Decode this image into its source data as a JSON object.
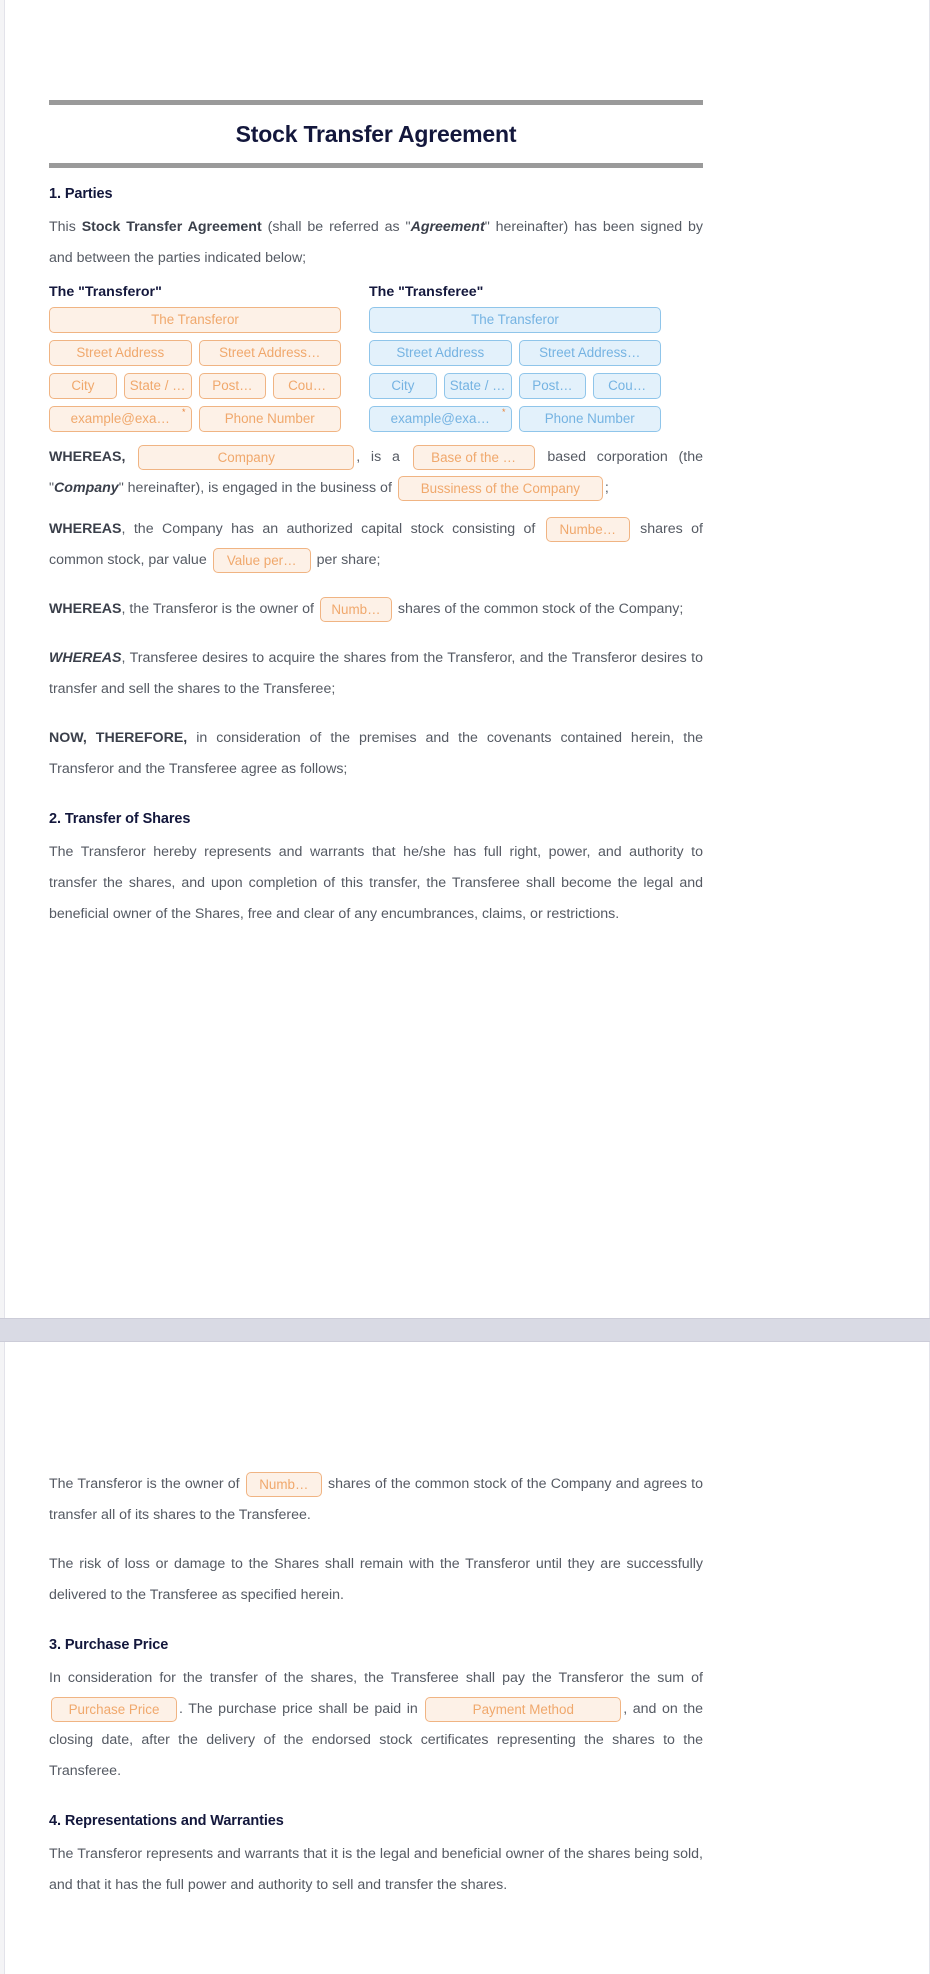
{
  "document": {
    "title": "Stock Transfer Agreement"
  },
  "sections": {
    "parties": {
      "heading": "1. Parties",
      "intro_a": "This ",
      "intro_b": "Stock Transfer Agreement",
      "intro_c": " (shall be referred as \"",
      "intro_d": "Agreement",
      "intro_e": "\" hereinafter) has been signed by and between the parties indicated below;",
      "transferor_label": "The \"Transferor\"",
      "transferee_label": "The \"Transferee\"",
      "transferor_fields": {
        "name": "The Transferor",
        "street_address_1": "Street Address",
        "street_address_2": "Street Address…",
        "city": "City",
        "state": "State / …",
        "postal": "Post…",
        "country": "Cou…",
        "email": "example@exa…",
        "email_required": "*",
        "phone": "Phone Number"
      },
      "transferee_fields": {
        "name": "The Transferor",
        "street_address_1": "Street Address",
        "street_address_2": "Street Address…",
        "city": "City",
        "state": "State / …",
        "postal": "Post…",
        "country": "Cou…",
        "email": "example@exa…",
        "email_required": "*",
        "phone": "Phone Number"
      }
    },
    "whereas_1": {
      "lead": "WHEREAS,",
      "field_company": "Company",
      "mid_1": ", is a",
      "field_base": "Base of the …",
      "mid_2": "based corporation (the \"",
      "company_italic": "Company",
      "mid_3": "\" hereinafter), is engaged in the business of",
      "field_business": "Bussiness of the Company",
      "tail": ";"
    },
    "whereas_2": {
      "lead": "WHEREAS",
      "text_1": ", the Company has an authorized capital stock consisting of",
      "field_number": "Numbe…",
      "text_2": "shares of common stock, par value",
      "field_value": "Value per…",
      "text_3": "per share;"
    },
    "whereas_3": {
      "lead": "WHEREAS",
      "text_1": ", the Transferor is the owner of",
      "field_number": "Numb…",
      "text_2": "shares of the common stock of the Company;"
    },
    "whereas_4": {
      "lead": "WHEREAS",
      "text": ", Transferee desires to acquire the shares from the Transferor, and the Transferor desires to transfer and sell the shares to the Transferee;"
    },
    "now_therefore": {
      "lead": "NOW, THEREFORE,",
      "text": " in consideration of the premises and the covenants contained herein, the Transferor and the Transferee agree as follows;"
    },
    "transfer_of_shares": {
      "heading": "2. Transfer of Shares",
      "paragraph_1": "The Transferor hereby represents and warrants that he/she has full right, power, and authority to transfer the shares, and upon completion of this transfer, the Transferee shall become the legal and beneficial owner of the Shares, free and clear of any encumbrances, claims, or restrictions.",
      "paragraph_2_text_1": "The Transferor is the owner of",
      "paragraph_2_field": "Numb…",
      "paragraph_2_text_2": "shares of the common stock of the Company and agrees to transfer all of its shares to the Transferee.",
      "paragraph_3": "The risk of loss or damage to the Shares shall remain with the Transferor until they are successfully delivered to the Transferee as specified herein."
    },
    "purchase_price": {
      "heading": "3. Purchase Price",
      "text_1": "In consideration for the transfer of the shares, the Transferee shall pay the Transferor the sum of",
      "field_price": "Purchase Price",
      "text_2": ". The purchase price shall be paid in",
      "field_method": "Payment Method",
      "text_3": ", and on the closing date, after the delivery of the endorsed stock certificates representing the shares to the Transferee."
    },
    "representations": {
      "heading": "4. Representations and Warranties",
      "paragraph_1": "The Transferor represents and warrants that it is the legal and beneficial owner of the shares being sold, and that it has the full power and authority to sell and transfer the shares."
    }
  }
}
